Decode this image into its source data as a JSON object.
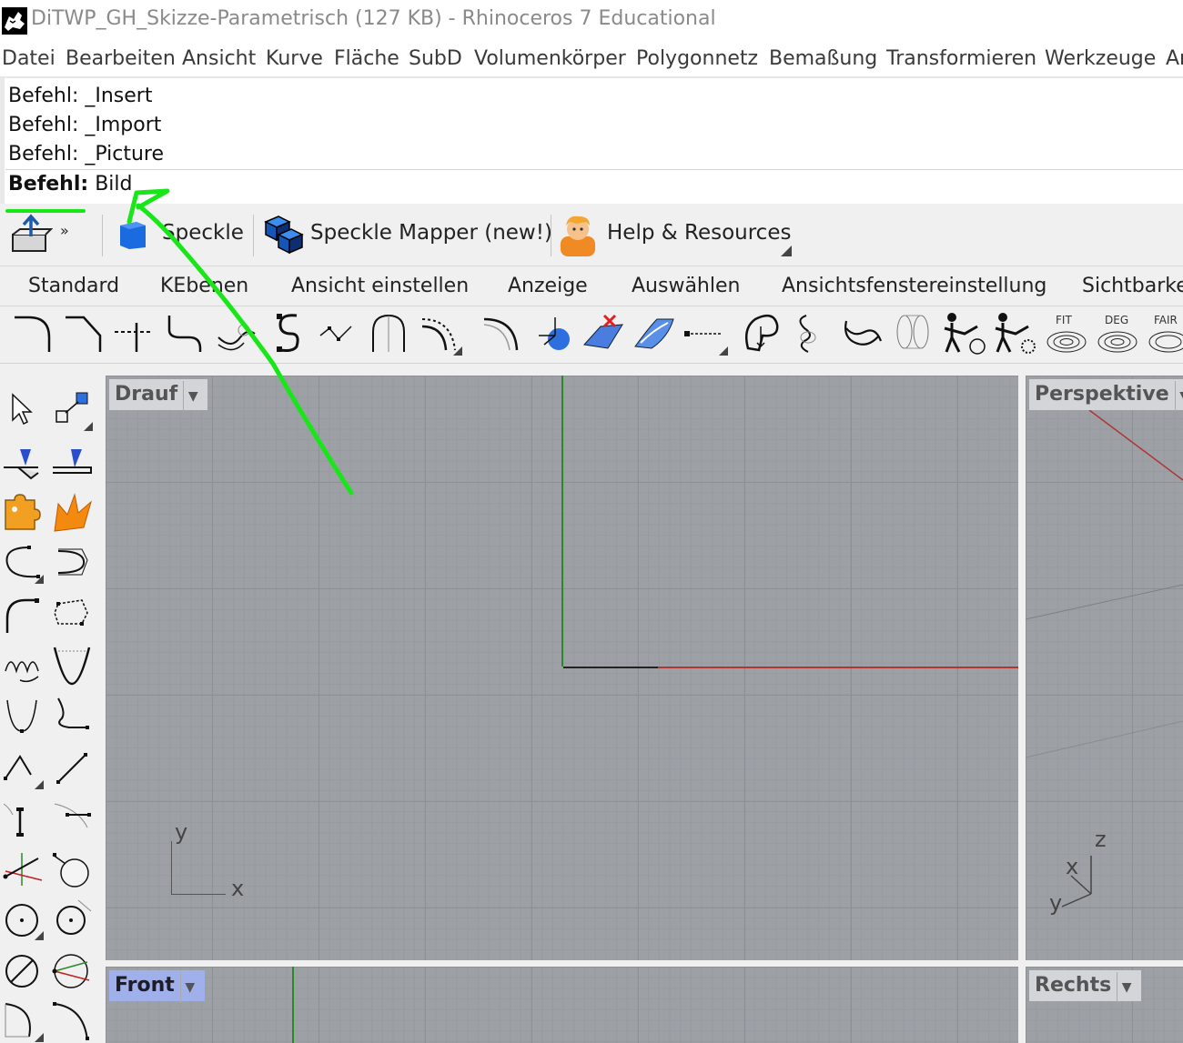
{
  "window": {
    "title": "DiTWP_GH_Skizze-Parametrisch (127 KB) - Rhinoceros 7 Educational",
    "logo_icon": "rhino-logo-icon"
  },
  "menu": {
    "items": [
      "Datei",
      "Bearbeiten",
      "Ansicht",
      "Kurve",
      "Fläche",
      "SubD",
      "Volumenkörper",
      "Polygonnetz",
      "Bemaßung",
      "Transformieren",
      "Werkzeuge",
      "Ar"
    ]
  },
  "command": {
    "history": [
      "Befehl: _Insert",
      "Befehl: _Import",
      "Befehl: _Picture"
    ],
    "prompt_label": "Befehl:",
    "prompt_value": "Bild"
  },
  "plugin_bar": {
    "overflow": "»",
    "speckle": "Speckle",
    "speckle_mapper": "Speckle Mapper (new!)",
    "help": "Help & Resources"
  },
  "tabs": [
    "Standard",
    "KEbenen",
    "Ansicht einstellen",
    "Anzeige",
    "Auswählen",
    "Ansichtsfenstereinstellung",
    "Sichtbarke"
  ],
  "icon_labels": {
    "fit": "FIT",
    "deg": "DEG",
    "fair": "FAIR"
  },
  "viewports": {
    "top": {
      "label": "Drauf",
      "axis_x": "x",
      "axis_y": "y"
    },
    "perspective": {
      "label": "Perspektive",
      "axis_x": "x",
      "axis_y": "y",
      "axis_z": "z"
    },
    "front": {
      "label": "Front"
    },
    "right": {
      "label": "Rechts"
    }
  },
  "colors": {
    "annotation": "#19e619",
    "x_axis": "#b03535",
    "y_axis": "#2a8a2a",
    "active_viewport_label": "#9fb0ea",
    "viewport_bg": "#9da1a6"
  }
}
